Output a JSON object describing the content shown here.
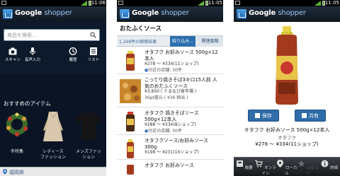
{
  "status": {
    "time": "11:06",
    "time2": "11:05"
  },
  "app": {
    "title_g": "Google",
    "title_s": "shopper"
  },
  "home": {
    "search_placeholder": "商品を検索...",
    "tools": [
      {
        "label": "スキャン"
      },
      {
        "label": "音声入力"
      },
      {
        "label": "履歴"
      },
      {
        "label": "リスト"
      }
    ],
    "recommended_heading": "おすすめのアイテム",
    "items": [
      {
        "label": "冬特集"
      },
      {
        "label": "レディース\nファッション"
      },
      {
        "label": "メンズファッ\nション"
      }
    ],
    "location": "福岡県"
  },
  "results": {
    "query": "おたふくソース",
    "count": "1,348件の検索結果",
    "filter_label": "絞り込み...",
    "sort_label": "関連度順",
    "rows": [
      {
        "title": "オタフク お好みソース 500g×12本入",
        "price": "¥278 ～ ¥334(11ショップ)",
        "note": "付近の店舗: 30件"
      },
      {
        "title": "こってり焼きそば3キロ15人前 人気のおたふくソース",
        "price": "¥3,850 ( ぐるなび食市場 )",
        "note": "36pt還元 ( ¥36 相当 )"
      },
      {
        "title": "オタフク 焼きそばソース 500g×12本入",
        "price": "¥288 ～ ¥334(8ショップ)",
        "note": "付近の店舗: 30件"
      },
      {
        "title": "オタフクソース/お好みソース 300g",
        "price": "¥198 ～ ¥231(10ショップ)",
        "note": ""
      },
      {
        "title": "オタフク お好みソース",
        "price": "",
        "note": ""
      }
    ]
  },
  "detail": {
    "save_label": "保存",
    "share_label": "共有",
    "title": "オタフク お好みソース 500g×12本入",
    "maker": "オタフク",
    "price": "¥278 ～ ¥334(11ショップ)",
    "nav": [
      {
        "label": "概要"
      },
      {
        "label": "オンライン"
      },
      {
        "label": "ローカル"
      },
      {
        "label": "レビュー"
      },
      {
        "label": "詳細"
      }
    ]
  }
}
